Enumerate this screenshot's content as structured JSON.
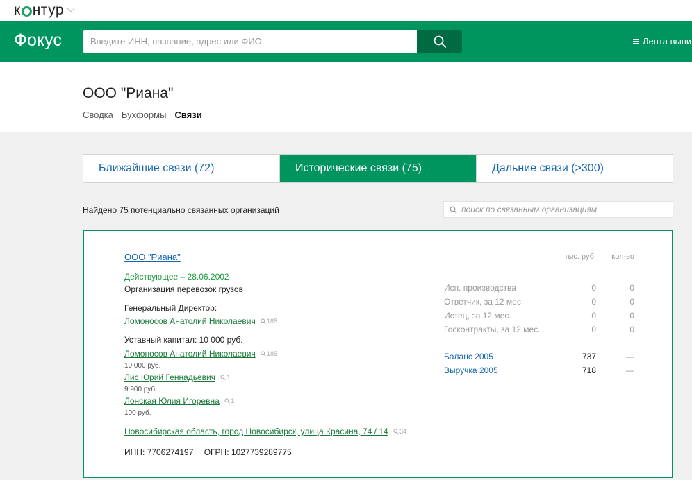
{
  "topbar": {
    "logo_left": "к",
    "logo_right": "нтур"
  },
  "header": {
    "brand": "Фокус",
    "search_placeholder": "Введите ИНН, название, адрес или ФИО",
    "feed_label": "Лента выпи"
  },
  "company": {
    "title": "ООО \"Риана\"",
    "nav": [
      "Сводка",
      "Бухформы",
      "Связи"
    ],
    "nav_active": "Связи"
  },
  "tabs": [
    {
      "label": "Ближайшие связи (72)",
      "active": false
    },
    {
      "label": "Исторические связи (75)",
      "active": true
    },
    {
      "label": "Дальние связи (>300)",
      "active": false
    }
  ],
  "found_text": "Найдено 75 потенциально связанных организаций",
  "filter_placeholder": "поиск по связанным организациям",
  "card": {
    "name": "ООО \"Риана\"",
    "status": "Действующее – 28.06.2002",
    "activity": "Организация перевозок грузов",
    "director_label": "Генеральный Директор:",
    "director": {
      "name": "Ломоносов Анатолий Николаевич",
      "count": "185"
    },
    "capital_label": "Уставный капитал: 10 000 руб.",
    "founders": [
      {
        "name": "Ломоносов Анатолий Николаевич",
        "count": "185",
        "share": "10 000 руб."
      },
      {
        "name": "Лис Юрий Геннадьевич",
        "count": "1",
        "share": "9 900 руб."
      },
      {
        "name": "Лонская Юлия Игоревна",
        "count": "1",
        "share": "100 руб."
      }
    ],
    "address": {
      "text": "Новосибирская область, город Новосибирск, улица Красина, 74 / 14",
      "count": "34"
    },
    "inn": "ИНН: 7706274197",
    "ogrn": "ОГРН: 1027739289775",
    "stats_headers": {
      "thousand_rub": "тыс. руб.",
      "count": "кол-во"
    },
    "stats": [
      {
        "label": "Исп. производства",
        "v1": "0",
        "v2": "0"
      },
      {
        "label": "Ответчик, за 12 мес.",
        "v1": "0",
        "v2": "0"
      },
      {
        "label": "Истец, за 12 мес.",
        "v1": "0",
        "v2": "0"
      },
      {
        "label": "Госконтракты, за 12 мес.",
        "v1": "0",
        "v2": "0"
      }
    ],
    "finance": [
      {
        "label": "Баланс 2005",
        "v1": "737",
        "v2": "—"
      },
      {
        "label": "Выручка 2005",
        "v1": "718",
        "v2": "—"
      }
    ]
  },
  "colors": {
    "brand_green": "#00955e",
    "dark_green": "#006b43",
    "link_blue": "#1566b0",
    "status_green": "#1a9a3a"
  }
}
